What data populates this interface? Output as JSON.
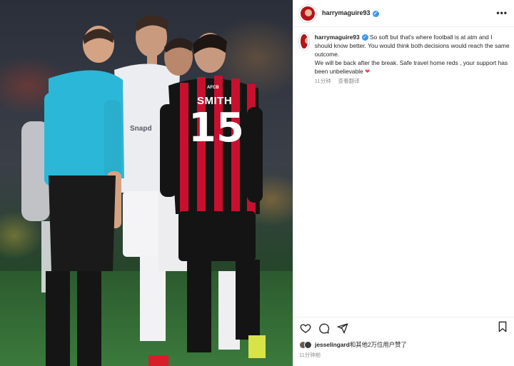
{
  "post": {
    "username": "harrymaguire93",
    "verified_mark": "✓",
    "more_icon": "•••"
  },
  "caption": {
    "username": "harrymaguire93",
    "line1": "So soft but that's where football is at atm and I should know better. You would think both decisions would reach the same outcome.",
    "line2": "We will be back after the break. Safe travel home reds , your support has been unbelievable",
    "heart": "❤",
    "time": "11分钟",
    "translate": "查看翻译"
  },
  "photo": {
    "shirt_name": "SMITH",
    "shirt_number": "15",
    "shirt_badge": "AFCB",
    "sponsor": "Snapd"
  },
  "likes": {
    "user": "jesselingard",
    "rest": "和其他2万位用户赞了"
  },
  "footer": {
    "time": "11分钟前"
  },
  "colors": {
    "accent_blue": "#3897f0",
    "heart_red": "#ed4956",
    "referee_shirt": "#2bb7d8",
    "bournemouth_red": "#c8102e"
  },
  "icons": [
    "heart-icon",
    "comment-icon",
    "share-icon",
    "bookmark-icon",
    "more-icon",
    "verified-icon"
  ]
}
